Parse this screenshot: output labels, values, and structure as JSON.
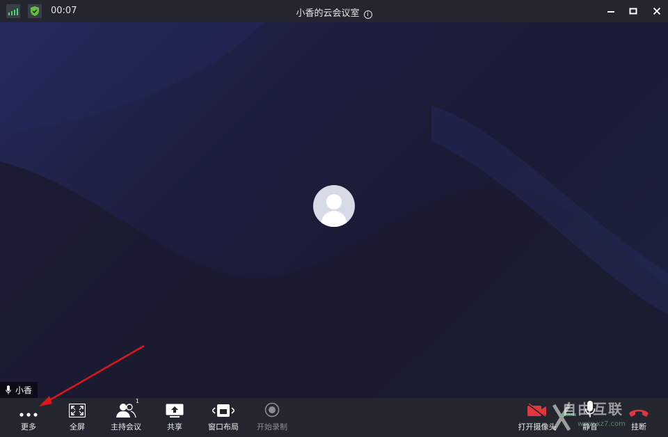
{
  "titlebar": {
    "timer": "00:07",
    "meeting_title": "小香的云会议室",
    "info_glyph": "i",
    "icons": [
      "signal-icon",
      "shield-icon",
      "minimize-icon",
      "maximize-icon",
      "close-icon"
    ]
  },
  "stage": {
    "participant_name": "小香",
    "icons": [
      "avatar-icon",
      "microphone-icon"
    ]
  },
  "toolbar": {
    "items": [
      {
        "label": "更多",
        "icon": "more-dots-icon"
      },
      {
        "label": "全屏",
        "icon": "fullscreen-icon"
      },
      {
        "label": "主持会议",
        "icon": "host-meeting-icon",
        "badge": "1"
      },
      {
        "label": "共享",
        "icon": "share-screen-icon"
      },
      {
        "label": "窗口布局",
        "icon": "window-layout-icon"
      },
      {
        "label": "开始录制",
        "icon": "record-icon",
        "disabled": true
      },
      {
        "label": "打开摄像头",
        "icon": "camera-off-icon"
      },
      {
        "label": "静音",
        "icon": "microphone-icon"
      },
      {
        "label": "挂断",
        "icon": "hang-up-icon"
      }
    ]
  },
  "watermark": {
    "text": "自由互联",
    "url": "www.xz7.com"
  },
  "colors": {
    "titlebar_bg": "#23262f",
    "toolbar_bg": "#24262f",
    "stage_bg": "#1a1b2e",
    "signal_green": "#4cd964",
    "annotation_red": "#e0161c"
  }
}
